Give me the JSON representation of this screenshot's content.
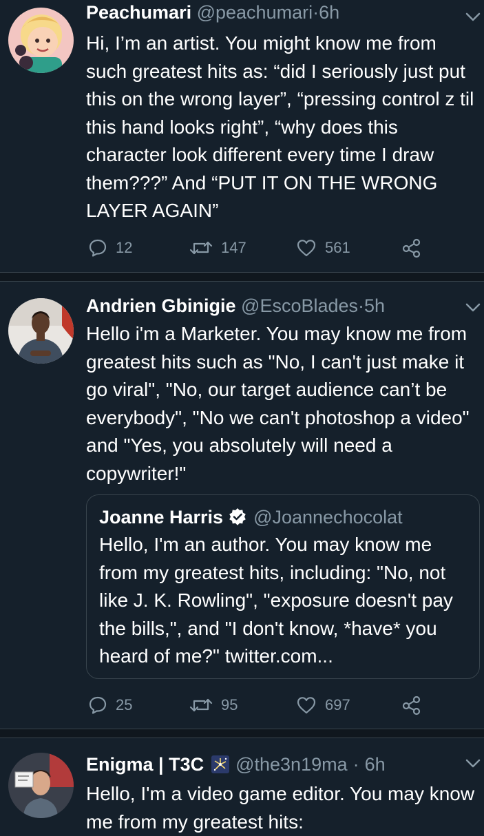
{
  "tweets": [
    {
      "name": "Peachumari",
      "handle": "@peachumari",
      "time": "6h",
      "text": "Hi, I’m an artist. You might know me from such greatest hits as: “did I seriously just put this on the wrong layer”, “pressing control z til this hand looks right”, “why does this character look different every time I draw them???” And “PUT IT ON THE WRONG LAYER AGAIN”",
      "replies": "12",
      "retweets": "147",
      "likes": "561"
    },
    {
      "name": "Andrien Gbinigie",
      "handle": "@EscoBlades",
      "time": "5h",
      "text": "Hello i'm a Marketer. You may know me from greatest hits such as \"No, I can't just make it go viral\", \"No, our target audience can’t be everybody\", \"No we can't photoshop a video\" and \"Yes, you absolutely will need a copywriter!\"",
      "quote": {
        "name": "Joanne Harris",
        "handle": "@Joannechocolat",
        "text": "Hello, I'm an author. You may know me from my greatest hits, including: \"No, not like J. K. Rowling\", \"exposure doesn't pay the bills,\", and \"I don't know, *have* you heard of me?\" twitter.com..."
      },
      "replies": "25",
      "retweets": "95",
      "likes": "697"
    },
    {
      "name": "Enigma | T3C",
      "handle": "@the3n19ma",
      "time": "6h",
      "text": "Hello, I'm a video game editor. You may know me from my greatest hits:"
    }
  ],
  "separator": "·",
  "colors": {
    "background": "#15202b",
    "divider": "#10171e",
    "border": "#38444d",
    "secondary_text": "#8899a6",
    "verified": "#ffffff"
  },
  "icons": {
    "reply": "speech-bubble-icon",
    "retweet": "retweet-arrows-icon",
    "like": "heart-icon",
    "share": "share-nodes-icon",
    "menu": "chevron-down-icon",
    "verified": "verified-badge-icon",
    "emoji": "fireworks-emoji-icon"
  }
}
